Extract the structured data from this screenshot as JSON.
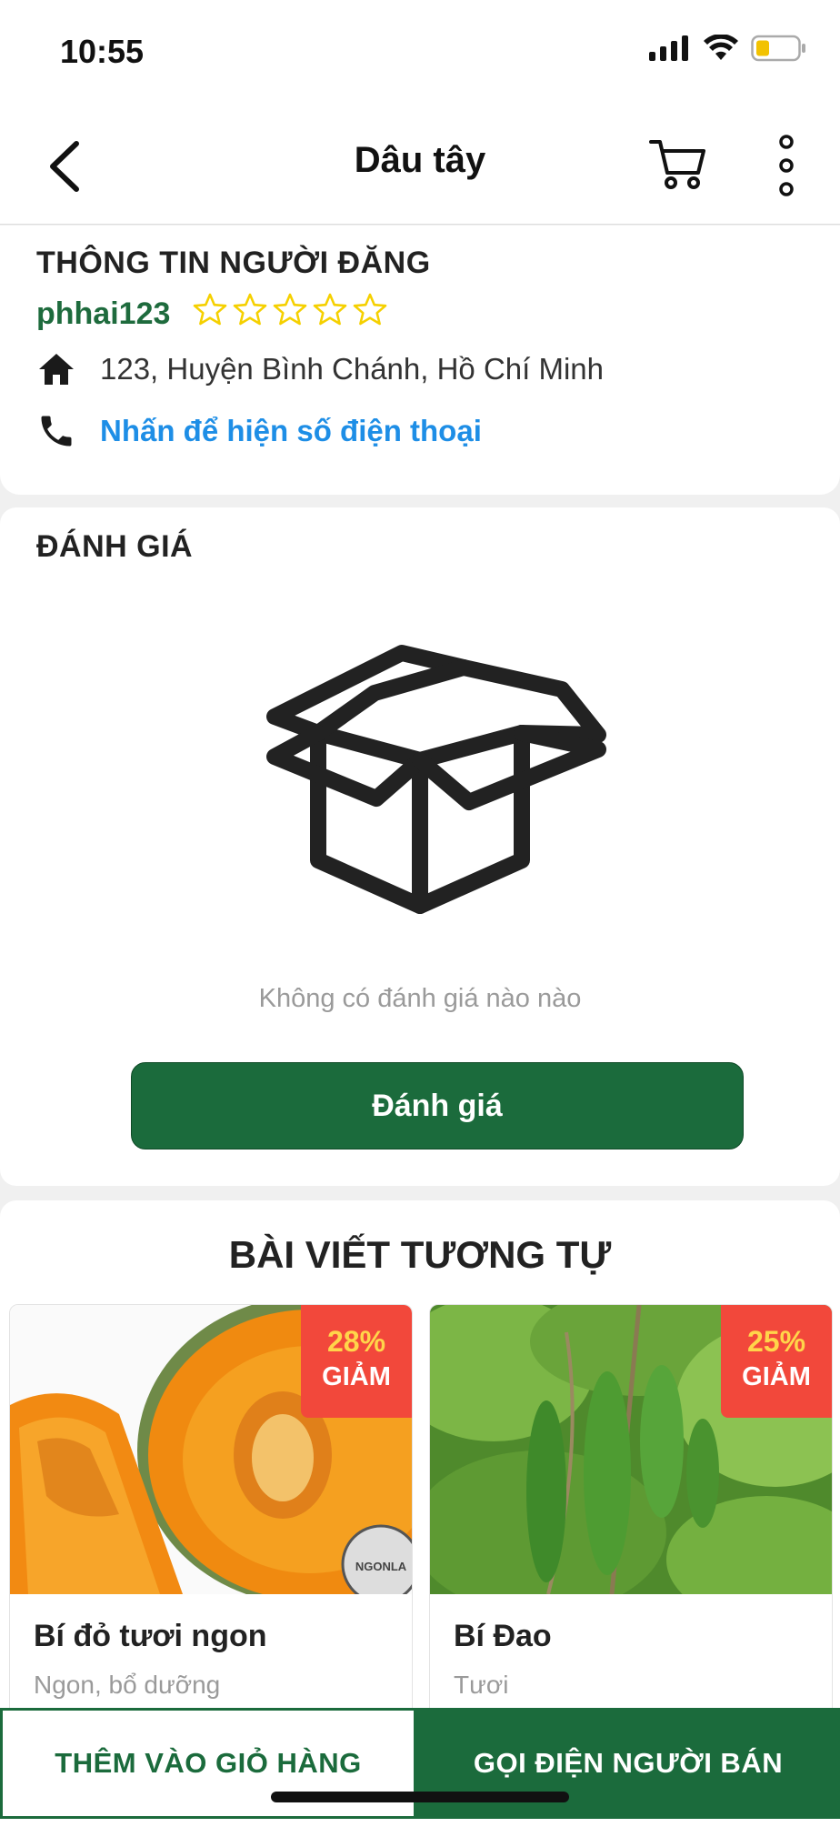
{
  "status_bar": {
    "time": "10:55"
  },
  "header": {
    "title": "Dâu tây",
    "icons": [
      "back-icon",
      "cart-icon",
      "more-vertical-icon"
    ]
  },
  "seller_info": {
    "heading": "THÔNG TIN NGƯỜI ĐĂNG",
    "username": "phhai123",
    "rating_stars": 0,
    "rating_max": 5,
    "address": "123, Huyện Bình Chánh, Hồ Chí Minh",
    "phone_prompt": "Nhấn để hiện số điện thoại"
  },
  "reviews": {
    "heading": "ĐÁNH GIÁ",
    "empty_text": "Không có đánh giá nào nào",
    "button_label": "Đánh giá"
  },
  "similar": {
    "heading": "BÀI VIẾT TƯƠNG TỰ",
    "products": [
      {
        "name": "Bí đỏ tươi ngon",
        "description": "Ngon, bổ dưỡng",
        "discount": "28%",
        "discount_label": "GIẢM",
        "watermark": "NGONLA"
      },
      {
        "name": "Bí Đao",
        "description": "Tươi",
        "discount": "25%",
        "discount_label": "GIẢM"
      }
    ]
  },
  "actions": {
    "add_to_cart": "THÊM VÀO GIỎ HÀNG",
    "call_seller": "GỌI ĐIỆN NGƯỜI BÁN"
  },
  "colors": {
    "primary": "#1b6b3c",
    "link": "#1e8ee6",
    "badge": "#f2483b",
    "badge_percent": "#ffd54a",
    "star": "#f5d000"
  }
}
